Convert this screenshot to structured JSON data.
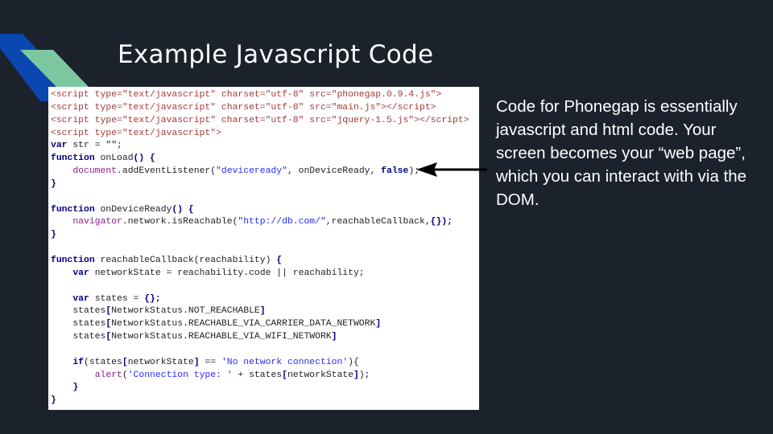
{
  "slide": {
    "title": "Example Javascript Code",
    "description": "Code for Phonegap is essentially javascript and html code. Your screen becomes your “web page”, which you can interact with via the DOM.",
    "colors": {
      "background": "#1c222c",
      "accent_blue": "#0a47b0",
      "accent_green": "#7dc7a0"
    }
  },
  "code_lines": [
    [
      [
        "tag",
        "<script type=\"text/javascript\" charset=\"utf-8\" src=\"phonegap.0.9.4.js\">"
      ]
    ],
    [
      [
        "tag",
        "<script type=\"text/javascript\" charset=\"utf-8\" src=\"main.js\"></script>"
      ]
    ],
    [
      [
        "tag",
        "<script type=\"text/javascript\" charset=\"utf-8\" src=\"jquery-1.5.js\"></script>"
      ]
    ],
    [
      [
        "tag",
        "<script type=\"text/javascript\">"
      ]
    ],
    [
      [
        "kw",
        "var"
      ],
      [
        "plain",
        " str = \"\";"
      ]
    ],
    [
      [
        "kw",
        "function"
      ],
      [
        "plain",
        " onLoad"
      ],
      [
        "kw",
        "() {"
      ]
    ],
    [
      [
        "plain",
        "    "
      ],
      [
        "obj",
        "document"
      ],
      [
        "plain",
        ".addEventListener("
      ],
      [
        "str",
        "\"deviceready\""
      ],
      [
        "plain",
        ", onDeviceReady, "
      ],
      [
        "kw",
        "false"
      ],
      [
        "plain",
        ");"
      ]
    ],
    [
      [
        "kw",
        "}"
      ]
    ],
    [
      [
        "plain",
        ""
      ]
    ],
    [
      [
        "kw",
        "function"
      ],
      [
        "plain",
        " onDeviceReady"
      ],
      [
        "kw",
        "() {"
      ]
    ],
    [
      [
        "plain",
        "    "
      ],
      [
        "obj",
        "navigator"
      ],
      [
        "plain",
        ".network.isReachable("
      ],
      [
        "str",
        "\"http://db.com/\""
      ],
      [
        "plain",
        ",reachableCallback,"
      ],
      [
        "kw",
        "{});"
      ]
    ],
    [
      [
        "kw",
        "}"
      ]
    ],
    [
      [
        "plain",
        ""
      ]
    ],
    [
      [
        "kw",
        "function"
      ],
      [
        "plain",
        " reachableCallback(reachability) "
      ],
      [
        "kw",
        "{"
      ]
    ],
    [
      [
        "plain",
        "    "
      ],
      [
        "kw",
        "var"
      ],
      [
        "plain",
        " networkState = reachability.code || reachability;"
      ]
    ],
    [
      [
        "plain",
        ""
      ]
    ],
    [
      [
        "plain",
        "    "
      ],
      [
        "kw",
        "var"
      ],
      [
        "plain",
        " states = "
      ],
      [
        "kw",
        "{};"
      ]
    ],
    [
      [
        "plain",
        "    states"
      ],
      [
        "kw",
        "["
      ],
      [
        "plain",
        "NetworkStatus.NOT_REACHABLE"
      ],
      [
        "kw",
        "]"
      ]
    ],
    [
      [
        "plain",
        "    states"
      ],
      [
        "kw",
        "["
      ],
      [
        "plain",
        "NetworkStatus.REACHABLE_VIA_CARRIER_DATA_NETWORK"
      ],
      [
        "kw",
        "]"
      ]
    ],
    [
      [
        "plain",
        "    states"
      ],
      [
        "kw",
        "["
      ],
      [
        "plain",
        "NetworkStatus.REACHABLE_VIA_WIFI_NETWORK"
      ],
      [
        "kw",
        "]"
      ]
    ],
    [
      [
        "plain",
        ""
      ]
    ],
    [
      [
        "plain",
        "    "
      ],
      [
        "kw",
        "if"
      ],
      [
        "plain",
        "(states"
      ],
      [
        "kw",
        "["
      ],
      [
        "plain",
        "networkState"
      ],
      [
        "kw",
        "]"
      ],
      [
        "plain",
        " == "
      ],
      [
        "str",
        "'No network connection'"
      ],
      [
        "plain",
        "){"
      ]
    ],
    [
      [
        "plain",
        "        "
      ],
      [
        "obj",
        "alert"
      ],
      [
        "plain",
        "("
      ],
      [
        "str",
        "'Connection type: '"
      ],
      [
        "plain",
        " + states"
      ],
      [
        "kw",
        "["
      ],
      [
        "plain",
        "networkState"
      ],
      [
        "kw",
        "]"
      ],
      [
        "plain",
        ");"
      ]
    ],
    [
      [
        "kw",
        "    }"
      ]
    ],
    [
      [
        "kw",
        "}"
      ]
    ]
  ]
}
